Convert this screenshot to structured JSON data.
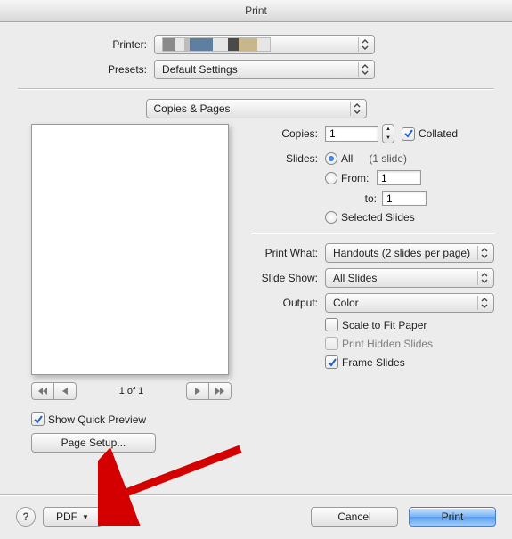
{
  "window": {
    "title": "Print"
  },
  "header": {
    "printer_label": "Printer:",
    "presets_label": "Presets:",
    "presets_value": "Default Settings",
    "section_value": "Copies & Pages"
  },
  "copies": {
    "label": "Copies:",
    "value": "1",
    "collated_label": "Collated",
    "collated_checked": true
  },
  "slides": {
    "label": "Slides:",
    "all_label": "All",
    "all_note": "(1 slide)",
    "from_label": "From:",
    "from_value": "1",
    "to_label": "to:",
    "to_value": "1",
    "selected_label": "Selected Slides"
  },
  "print_what": {
    "label": "Print What:",
    "value": "Handouts (2 slides per page)"
  },
  "slide_show": {
    "label": "Slide Show:",
    "value": "All Slides"
  },
  "output": {
    "label": "Output:",
    "value": "Color"
  },
  "options": {
    "scale_label": "Scale to Fit Paper",
    "scale_checked": false,
    "hidden_label": "Print Hidden Slides",
    "hidden_checked": false,
    "hidden_disabled": true,
    "frame_label": "Frame Slides",
    "frame_checked": true
  },
  "preview": {
    "page_indicator": "1 of 1",
    "show_quick_label": "Show Quick Preview",
    "show_quick_checked": true,
    "page_setup_label": "Page Setup..."
  },
  "footer": {
    "pdf_label": "PDF",
    "cancel_label": "Cancel",
    "print_label": "Print"
  }
}
